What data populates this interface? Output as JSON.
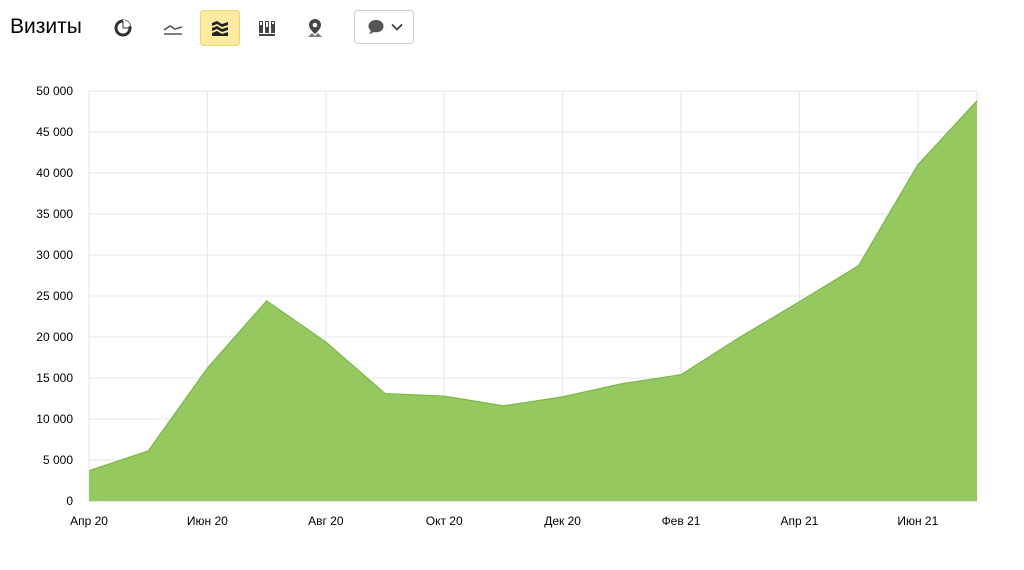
{
  "header": {
    "title": "Визиты",
    "toolbar": [
      {
        "name": "pie-chart-button",
        "icon": "pie-chart-icon",
        "active": false
      },
      {
        "name": "line-chart-button",
        "icon": "line-chart-icon",
        "active": false
      },
      {
        "name": "area-chart-button",
        "icon": "area-chart-icon",
        "active": true
      },
      {
        "name": "bar-chart-button",
        "icon": "bar-chart-icon",
        "active": false
      },
      {
        "name": "map-button",
        "icon": "map-pin-icon",
        "active": false
      }
    ],
    "dropdown": {
      "icon": "speech-bubble-icon",
      "arrow": "chevron-down-icon"
    }
  },
  "colors": {
    "area_fill": "#95c95f",
    "area_line": "#7ab648",
    "grid": "#e6e6e6",
    "active_button_bg": "#ffeba0"
  },
  "chart_data": {
    "type": "area",
    "x": [
      "2020-04",
      "2020-05",
      "2020-06",
      "2020-07",
      "2020-08",
      "2020-09",
      "2020-10",
      "2020-11",
      "2020-12",
      "2021-01",
      "2021-02",
      "2021-03",
      "2021-04",
      "2021-05",
      "2021-06",
      "2021-07"
    ],
    "series": [
      {
        "values": [
          3700,
          6100,
          16200,
          24400,
          19400,
          13100,
          12800,
          11600,
          12700,
          14300,
          15400,
          20000,
          24300,
          28700,
          41000,
          48800
        ]
      }
    ],
    "x_tick_labels": [
      "Апр 20",
      "Июн 20",
      "Авг 20",
      "Окт 20",
      "Дек 20",
      "Фев 21",
      "Апр 21",
      "Июн 21"
    ],
    "x_tick_indices": [
      0,
      2,
      4,
      6,
      8,
      10,
      12,
      14
    ],
    "y_tick_labels": [
      "0",
      "5 000",
      "10 000",
      "15 000",
      "20 000",
      "25 000",
      "30 000",
      "35 000",
      "40 000",
      "45 000",
      "50 000"
    ],
    "y_ticks": [
      0,
      5000,
      10000,
      15000,
      20000,
      25000,
      30000,
      35000,
      40000,
      45000,
      50000
    ],
    "ylim": [
      0,
      50000
    ],
    "grid": true,
    "legend": "none",
    "title": "",
    "xlabel": "",
    "ylabel": ""
  }
}
